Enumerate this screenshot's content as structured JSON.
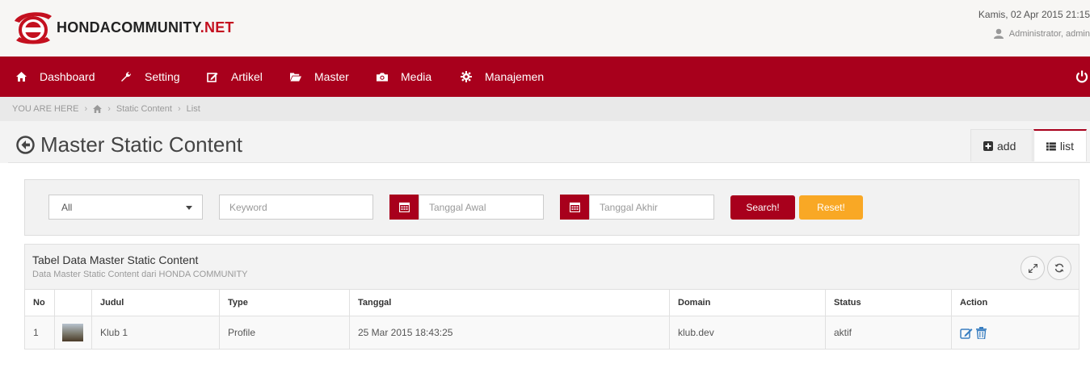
{
  "header": {
    "logo_main": "HONDACOMMUNITY",
    "logo_suffix": ".NET",
    "datetime": "Kamis, 02 Apr 2015 21:15",
    "user": "Administrator, admin"
  },
  "nav": {
    "items": [
      {
        "label": "Dashboard",
        "icon": "home-icon"
      },
      {
        "label": "Setting",
        "icon": "wrench-icon"
      },
      {
        "label": "Artikel",
        "icon": "edit-icon"
      },
      {
        "label": "Master",
        "icon": "folder-open-icon"
      },
      {
        "label": "Media",
        "icon": "camera-icon"
      },
      {
        "label": "Manajemen",
        "icon": "gear-icon"
      }
    ],
    "power_icon": "power-icon"
  },
  "breadcrumb": {
    "prefix": "YOU ARE HERE",
    "items": [
      "Static Content",
      "List"
    ]
  },
  "page": {
    "title": "Master Static Content",
    "tabs": {
      "add": "add",
      "list": "list"
    }
  },
  "filter": {
    "select_value": "All",
    "keyword_placeholder": "Keyword",
    "start_placeholder": "Tanggal Awal",
    "end_placeholder": "Tanggal Akhir",
    "search_label": "Search!",
    "reset_label": "Reset!"
  },
  "table": {
    "title": "Tabel Data Master Static Content",
    "subtitle": "Data Master Static Content dari HONDA COMMUNITY",
    "columns": [
      "No",
      "",
      "Judul",
      "Type",
      "Tanggal",
      "Domain",
      "Status",
      "Action"
    ],
    "rows": [
      {
        "no": "1",
        "judul": "Klub 1",
        "type": "Profile",
        "tanggal": "25 Mar 2015 18:43:25",
        "domain": "klub.dev",
        "status": "aktif"
      }
    ]
  },
  "colors": {
    "brand": "#a8001c",
    "reset": "#f9a825"
  }
}
